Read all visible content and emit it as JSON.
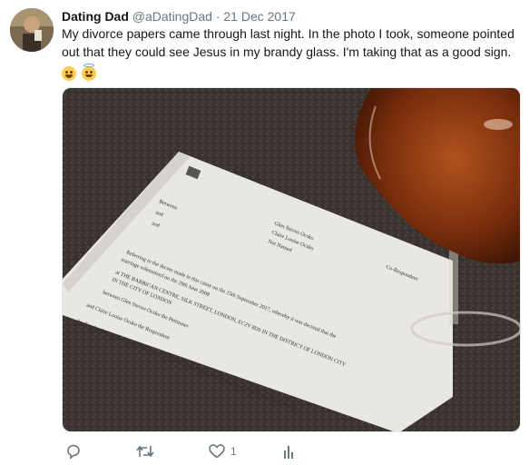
{
  "tweet": {
    "author_name": "Dating Dad",
    "author_handle": "@aDatingDad",
    "separator": "·",
    "date": "21 Dec 2017",
    "text": "My divorce papers came through last night. In the photo I took, someone pointed out that they could see Jesus in my brandy glass. I'm taking that as a good sign.",
    "emojis": [
      "grinning-face-icon",
      "smiling-face-with-halo-icon"
    ],
    "photo": {
      "document": {
        "court_header": "In the Family Court at BURY",
        "between": "Between",
        "and_1": "and",
        "and_2": "and",
        "name_1": "Glen Steven Ocsko",
        "name_2": "Claire Louise Ocsko",
        "not_named": "Not Named",
        "co_respondent": "Co-Respondent",
        "line_1": "Referring to the decree made in this cause on the 15th September 2017, whereby it was decreed that the",
        "line_2": "marriage solemnized on the 29th June 2008",
        "line_3": "at THE BARBICAN CENTRE, SILK STREET, LONDON, EC2Y 8DS IN THE DISTRICT OF LONDON CITY",
        "line_4": "IN THE CITY OF LONDON",
        "line_5": "between Glen Steven Ocsko the Petitioner",
        "line_6": "and Claire Louise Ocsko the Respondent",
        "line_7": "be dissolved unless sufficient cause be shown to the court within six weeks from the making thereof why the"
      }
    },
    "actions": {
      "reply_icon": "reply-icon",
      "retweet_icon": "retweet-icon",
      "like_icon": "heart-icon",
      "like_count": "1",
      "analytics_icon": "analytics-icon"
    }
  },
  "colors": {
    "text": "#14171a",
    "secondary": "#657786",
    "emoji_yellow": "#ffcc4d",
    "halo_blue": "#55acee"
  }
}
